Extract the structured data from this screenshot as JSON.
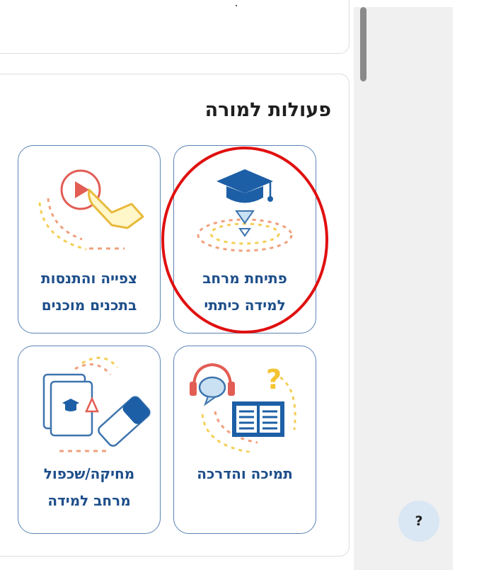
{
  "section": {
    "title": "פעולות למורה"
  },
  "tiles": [
    {
      "label_line1": "פתיחת מרחב",
      "label_line2": "למידה כיתתי",
      "icon": "graduation-cap-icon"
    },
    {
      "label_line1": "צפייה והתנסות",
      "label_line2": "בתכנים מוכנים",
      "icon": "touch-play-icon"
    },
    {
      "label_line1": "תמיכה והדרכה",
      "label_line2": "",
      "icon": "support-book-icon"
    },
    {
      "label_line1": "מחיקה/שכפול",
      "label_line2": "מרחב למידה",
      "icon": "eraser-copy-icon"
    }
  ],
  "help": {
    "label": "?"
  },
  "colors": {
    "tile_border": "#5b84b5",
    "label_text": "#1d4e8a",
    "highlight": "#e01010"
  }
}
